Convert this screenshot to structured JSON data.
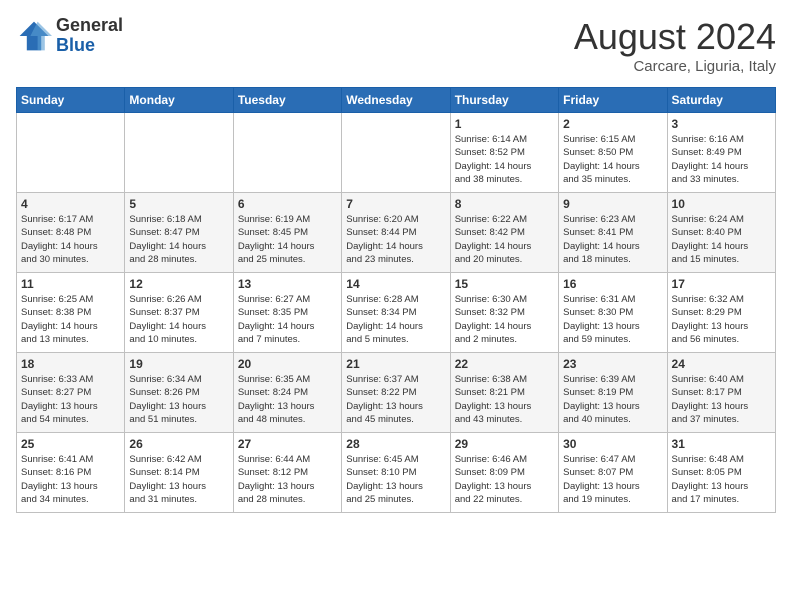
{
  "logo": {
    "general": "General",
    "blue": "Blue"
  },
  "title": "August 2024",
  "location": "Carcare, Liguria, Italy",
  "days_of_week": [
    "Sunday",
    "Monday",
    "Tuesday",
    "Wednesday",
    "Thursday",
    "Friday",
    "Saturday"
  ],
  "weeks": [
    [
      {
        "day": "",
        "info": ""
      },
      {
        "day": "",
        "info": ""
      },
      {
        "day": "",
        "info": ""
      },
      {
        "day": "",
        "info": ""
      },
      {
        "day": "1",
        "info": "Sunrise: 6:14 AM\nSunset: 8:52 PM\nDaylight: 14 hours\nand 38 minutes."
      },
      {
        "day": "2",
        "info": "Sunrise: 6:15 AM\nSunset: 8:50 PM\nDaylight: 14 hours\nand 35 minutes."
      },
      {
        "day": "3",
        "info": "Sunrise: 6:16 AM\nSunset: 8:49 PM\nDaylight: 14 hours\nand 33 minutes."
      }
    ],
    [
      {
        "day": "4",
        "info": "Sunrise: 6:17 AM\nSunset: 8:48 PM\nDaylight: 14 hours\nand 30 minutes."
      },
      {
        "day": "5",
        "info": "Sunrise: 6:18 AM\nSunset: 8:47 PM\nDaylight: 14 hours\nand 28 minutes."
      },
      {
        "day": "6",
        "info": "Sunrise: 6:19 AM\nSunset: 8:45 PM\nDaylight: 14 hours\nand 25 minutes."
      },
      {
        "day": "7",
        "info": "Sunrise: 6:20 AM\nSunset: 8:44 PM\nDaylight: 14 hours\nand 23 minutes."
      },
      {
        "day": "8",
        "info": "Sunrise: 6:22 AM\nSunset: 8:42 PM\nDaylight: 14 hours\nand 20 minutes."
      },
      {
        "day": "9",
        "info": "Sunrise: 6:23 AM\nSunset: 8:41 PM\nDaylight: 14 hours\nand 18 minutes."
      },
      {
        "day": "10",
        "info": "Sunrise: 6:24 AM\nSunset: 8:40 PM\nDaylight: 14 hours\nand 15 minutes."
      }
    ],
    [
      {
        "day": "11",
        "info": "Sunrise: 6:25 AM\nSunset: 8:38 PM\nDaylight: 14 hours\nand 13 minutes."
      },
      {
        "day": "12",
        "info": "Sunrise: 6:26 AM\nSunset: 8:37 PM\nDaylight: 14 hours\nand 10 minutes."
      },
      {
        "day": "13",
        "info": "Sunrise: 6:27 AM\nSunset: 8:35 PM\nDaylight: 14 hours\nand 7 minutes."
      },
      {
        "day": "14",
        "info": "Sunrise: 6:28 AM\nSunset: 8:34 PM\nDaylight: 14 hours\nand 5 minutes."
      },
      {
        "day": "15",
        "info": "Sunrise: 6:30 AM\nSunset: 8:32 PM\nDaylight: 14 hours\nand 2 minutes."
      },
      {
        "day": "16",
        "info": "Sunrise: 6:31 AM\nSunset: 8:30 PM\nDaylight: 13 hours\nand 59 minutes."
      },
      {
        "day": "17",
        "info": "Sunrise: 6:32 AM\nSunset: 8:29 PM\nDaylight: 13 hours\nand 56 minutes."
      }
    ],
    [
      {
        "day": "18",
        "info": "Sunrise: 6:33 AM\nSunset: 8:27 PM\nDaylight: 13 hours\nand 54 minutes."
      },
      {
        "day": "19",
        "info": "Sunrise: 6:34 AM\nSunset: 8:26 PM\nDaylight: 13 hours\nand 51 minutes."
      },
      {
        "day": "20",
        "info": "Sunrise: 6:35 AM\nSunset: 8:24 PM\nDaylight: 13 hours\nand 48 minutes."
      },
      {
        "day": "21",
        "info": "Sunrise: 6:37 AM\nSunset: 8:22 PM\nDaylight: 13 hours\nand 45 minutes."
      },
      {
        "day": "22",
        "info": "Sunrise: 6:38 AM\nSunset: 8:21 PM\nDaylight: 13 hours\nand 43 minutes."
      },
      {
        "day": "23",
        "info": "Sunrise: 6:39 AM\nSunset: 8:19 PM\nDaylight: 13 hours\nand 40 minutes."
      },
      {
        "day": "24",
        "info": "Sunrise: 6:40 AM\nSunset: 8:17 PM\nDaylight: 13 hours\nand 37 minutes."
      }
    ],
    [
      {
        "day": "25",
        "info": "Sunrise: 6:41 AM\nSunset: 8:16 PM\nDaylight: 13 hours\nand 34 minutes."
      },
      {
        "day": "26",
        "info": "Sunrise: 6:42 AM\nSunset: 8:14 PM\nDaylight: 13 hours\nand 31 minutes."
      },
      {
        "day": "27",
        "info": "Sunrise: 6:44 AM\nSunset: 8:12 PM\nDaylight: 13 hours\nand 28 minutes."
      },
      {
        "day": "28",
        "info": "Sunrise: 6:45 AM\nSunset: 8:10 PM\nDaylight: 13 hours\nand 25 minutes."
      },
      {
        "day": "29",
        "info": "Sunrise: 6:46 AM\nSunset: 8:09 PM\nDaylight: 13 hours\nand 22 minutes."
      },
      {
        "day": "30",
        "info": "Sunrise: 6:47 AM\nSunset: 8:07 PM\nDaylight: 13 hours\nand 19 minutes."
      },
      {
        "day": "31",
        "info": "Sunrise: 6:48 AM\nSunset: 8:05 PM\nDaylight: 13 hours\nand 17 minutes."
      }
    ]
  ]
}
